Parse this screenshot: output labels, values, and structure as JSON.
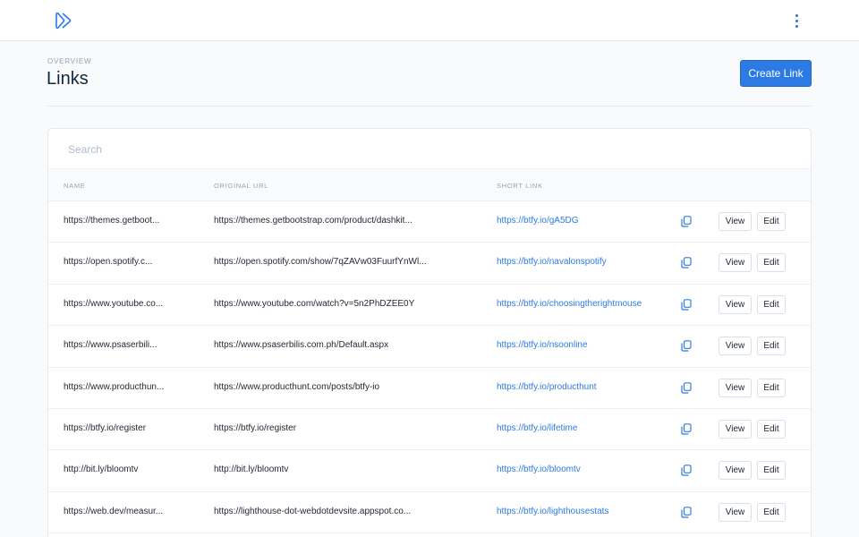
{
  "header": {
    "logo_icon": "play-forward-icon",
    "menu_icon": "vertical-dots-icon",
    "accent_color": "#2c7be5"
  },
  "page": {
    "overline": "OVERVIEW",
    "title": "Links",
    "create_label": "Create Link"
  },
  "search": {
    "placeholder": "Search",
    "value": ""
  },
  "table": {
    "columns": [
      "NAME",
      "ORIGINAL URL",
      "SHORT LINK"
    ],
    "view_label": "View",
    "edit_label": "Edit",
    "copy_icon": "copy-icon",
    "rows": [
      {
        "name": "https://themes.getboot...",
        "original": "https://themes.getbootstrap.com/product/dashkit...",
        "short": "https://btfy.io/gA5DG"
      },
      {
        "name": "https://open.spotify.c...",
        "original": "https://open.spotify.com/show/7qZAVw03FuurfYnWl...",
        "short": "https://btfy.io/navalonspotify"
      },
      {
        "name": "https://www.youtube.co...",
        "original": "https://www.youtube.com/watch?v=5n2PhDZEE0Y",
        "short": "https://btfy.io/choosingtherightmouse"
      },
      {
        "name": "https://www.psaserbili...",
        "original": "https://www.psaserbilis.com.ph/Default.aspx",
        "short": "https://btfy.io/nsoonline"
      },
      {
        "name": "https://www.producthun...",
        "original": "https://www.producthunt.com/posts/btfy-io",
        "short": "https://btfy.io/producthunt"
      },
      {
        "name": "https://btfy.io/register",
        "original": "https://btfy.io/register",
        "short": "https://btfy.io/lifetime"
      },
      {
        "name": "http://bit.ly/bloomtv",
        "original": "http://bit.ly/bloomtv",
        "short": "https://btfy.io/bloomtv"
      },
      {
        "name": "https://web.dev/measur...",
        "original": "https://lighthouse-dot-webdotdevsite.appspot.co...",
        "short": "https://btfy.io/lighthousestats"
      }
    ]
  }
}
